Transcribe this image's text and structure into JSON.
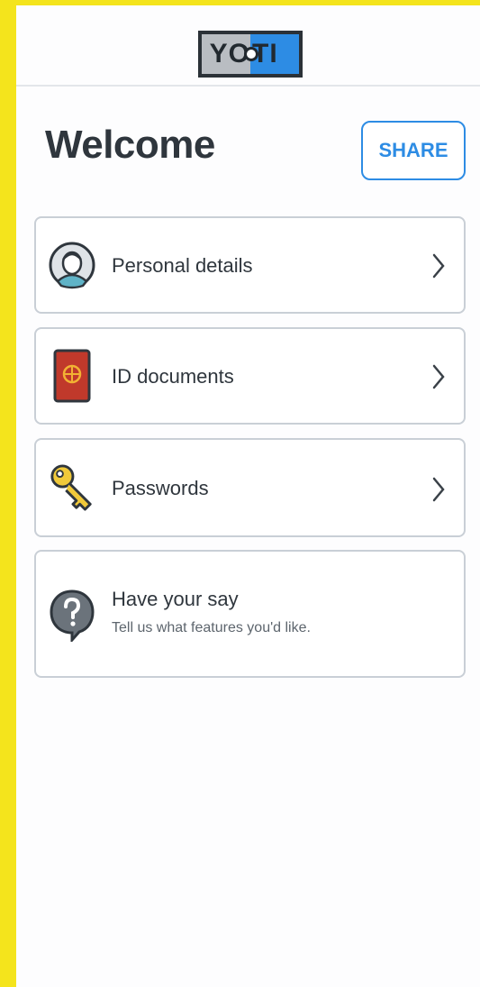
{
  "app": {
    "logo_text_left": "YO",
    "logo_text_right": "TI",
    "brand_colors": {
      "accent": "#2d8ce4",
      "background": "#f4e41c",
      "logo_gray": "#b9bdc2",
      "text_dark": "#2f363d"
    }
  },
  "page": {
    "title": "Welcome",
    "share_label": "SHARE"
  },
  "menu": {
    "items": [
      {
        "label": "Personal details",
        "icon": "person-avatar-icon",
        "has_chevron": true
      },
      {
        "label": "ID documents",
        "icon": "passport-icon",
        "has_chevron": true
      },
      {
        "label": "Passwords",
        "icon": "key-icon",
        "has_chevron": true
      },
      {
        "label": "Have your say",
        "sublabel": "Tell us what features you'd like.",
        "icon": "question-bubble-icon",
        "has_chevron": false
      }
    ]
  }
}
